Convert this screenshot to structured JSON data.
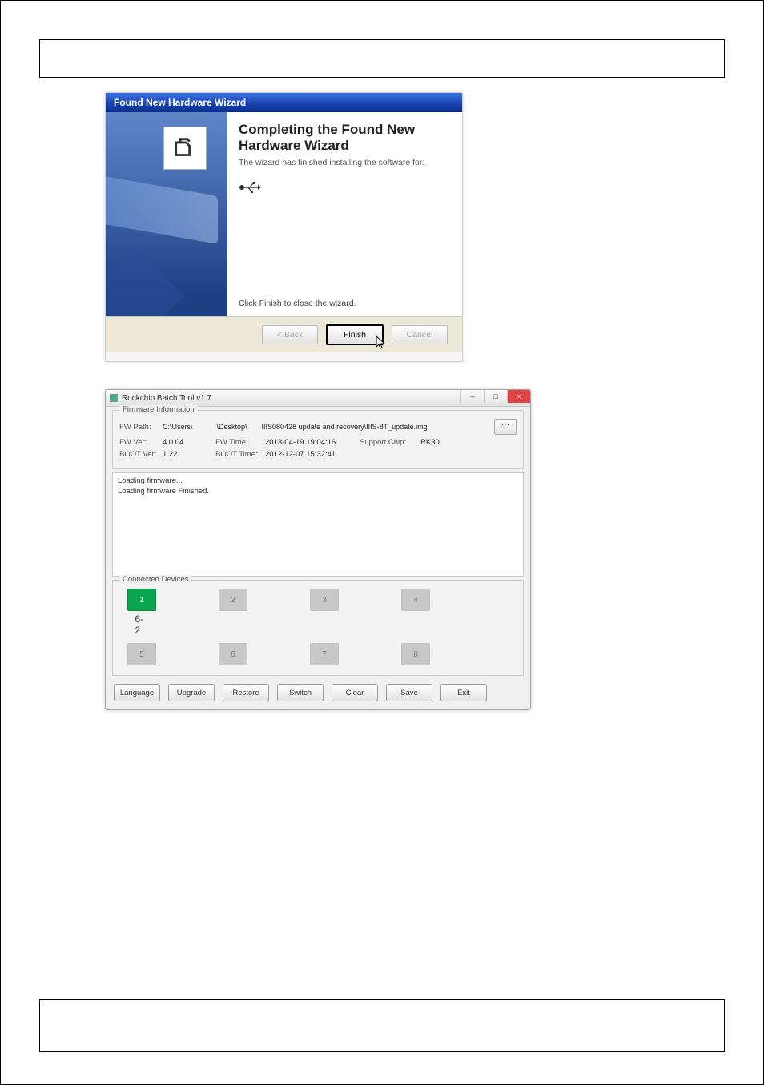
{
  "wizard": {
    "title": "Found New Hardware Wizard",
    "heading": "Completing the Found New Hardware Wizard",
    "subtext": "The wizard has finished installing the software for:",
    "close_text": "Click Finish to close the wizard.",
    "buttons": {
      "back": "< Back",
      "finish": "Finish",
      "cancel": "Cancel"
    }
  },
  "rk": {
    "title": "Rockchip Batch Tool v1.7",
    "groups": {
      "firmware": "Firmware Information",
      "devices": "Connected Devices"
    },
    "labels": {
      "fw_path": "FW Path:",
      "fw_ver": "FW Ver:",
      "boot_ver": "BOOT Ver:",
      "fw_time": "FW Time:",
      "boot_time": "BOOT Time:",
      "support_chip": "Support Chip:"
    },
    "values": {
      "fw_path_a": "C:\\Users\\",
      "fw_path_b": "\\Desktop\\",
      "fw_path_c": "IIIS080428 update and recovery\\IIIS-8T_update.img",
      "fw_ver": "4.0.04",
      "boot_ver": "1.22",
      "fw_time": "2013-04-19 19:04:16",
      "boot_time": "2012-12-07 15:32:41",
      "support_chip": "RK30"
    },
    "log": "Loading firmware...\nLoading firmware Finished.",
    "dev_labels": [
      "1",
      "2",
      "3",
      "4",
      "5",
      "6",
      "7",
      "8"
    ],
    "dev_sub": "6-2",
    "buttons": {
      "language": "Language",
      "upgrade": "Upgrade",
      "restore": "Restore",
      "switch": "Switch",
      "clear": "Clear",
      "save": "Save",
      "exit": "Exit"
    }
  }
}
